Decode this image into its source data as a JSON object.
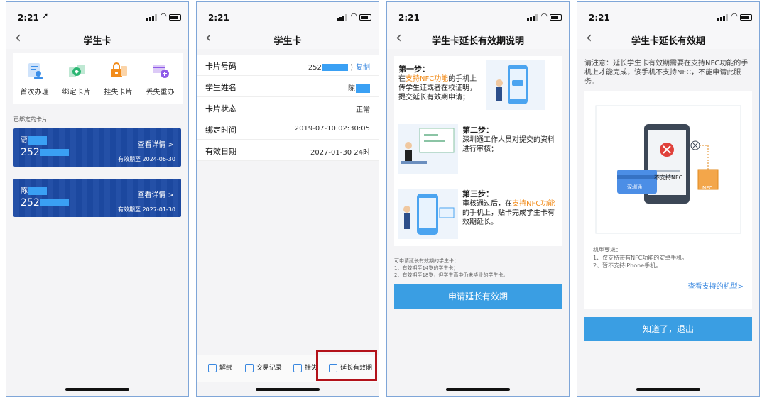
{
  "status": {
    "time": "2:21",
    "loc": "➚"
  },
  "panel1": {
    "title": "学生卡",
    "menu": [
      {
        "label": "首次办理",
        "icon": "first-apply-icon",
        "color": "#3b8ee8"
      },
      {
        "label": "绑定卡片",
        "icon": "bind-card-icon",
        "color": "#2bb673"
      },
      {
        "label": "挂失卡片",
        "icon": "report-loss-icon",
        "color": "#f28c1b"
      },
      {
        "label": "丢失重办",
        "icon": "reissue-icon",
        "color": "#8f5be8"
      }
    ],
    "section_label": "已绑定的卡片",
    "cards": [
      {
        "name": "贾",
        "number": "252",
        "detail": "查看详情 >",
        "expiry": "有效期至 2024-06-30"
      },
      {
        "name": "陈",
        "number": "252",
        "detail": "查看详情 >",
        "expiry": "有效期至 2027-01-30"
      }
    ]
  },
  "panel2": {
    "title": "学生卡",
    "rows": [
      {
        "label": "卡片号码",
        "value": "252",
        "extra": "复制"
      },
      {
        "label": "学生姓名",
        "value": "陈"
      },
      {
        "label": "卡片状态",
        "value": "正常"
      },
      {
        "label": "绑定时间",
        "value": "2019-07-10 02:30:05"
      },
      {
        "label": "有效日期",
        "value": "2027-01-30 24时"
      }
    ],
    "toolbar": [
      {
        "label": "解绑",
        "icon": "unbind-icon"
      },
      {
        "label": "交易记录",
        "icon": "transaction-record-icon"
      },
      {
        "label": "挂失",
        "icon": "report-loss-icon"
      },
      {
        "label": "延长有效期",
        "icon": "extend-validity-icon"
      }
    ]
  },
  "panel3": {
    "title": "学生卡延长有效期说明",
    "step1_title": "第一步：",
    "step1_pre": "在",
    "step1_highlight": "支持NFC功能",
    "step1_post": "的手机上传学生证或者在校证明，提交延长有效期申请；",
    "step2_title": "第二步：",
    "step2_text": "深圳通工作人员对提交的资料进行审核；",
    "step3_title": "第三步：",
    "step3_pre": "审核通过后，在",
    "step3_highlight": "支持NFC功能",
    "step3_post": "的手机上，贴卡完成学生卡有效期延长。",
    "note_title": "可申请延长有效期的学生卡：",
    "note_1": "1、有效期至14岁的学生卡；",
    "note_2": "2、有效期至18岁，但学生高中仍未毕业的学生卡。",
    "button": "申请延长有效期"
  },
  "panel4": {
    "title": "学生卡延长有效期",
    "warning": "请注意：延长学生卡有效期需要在支持NFC功能的手机上才能完成，该手机不支持NFC，不能申请此服务。",
    "unsupported_label": "不支持NFC",
    "card_label": "深圳通",
    "nfc_tag": "NFC",
    "req_title": "机型要求：",
    "req_1": "1、仅支持带有NFC功能的安卓手机。",
    "req_2": "2、暂不支持iPhone手机。",
    "link": "查看支持的机型>",
    "button": "知道了，退出"
  }
}
